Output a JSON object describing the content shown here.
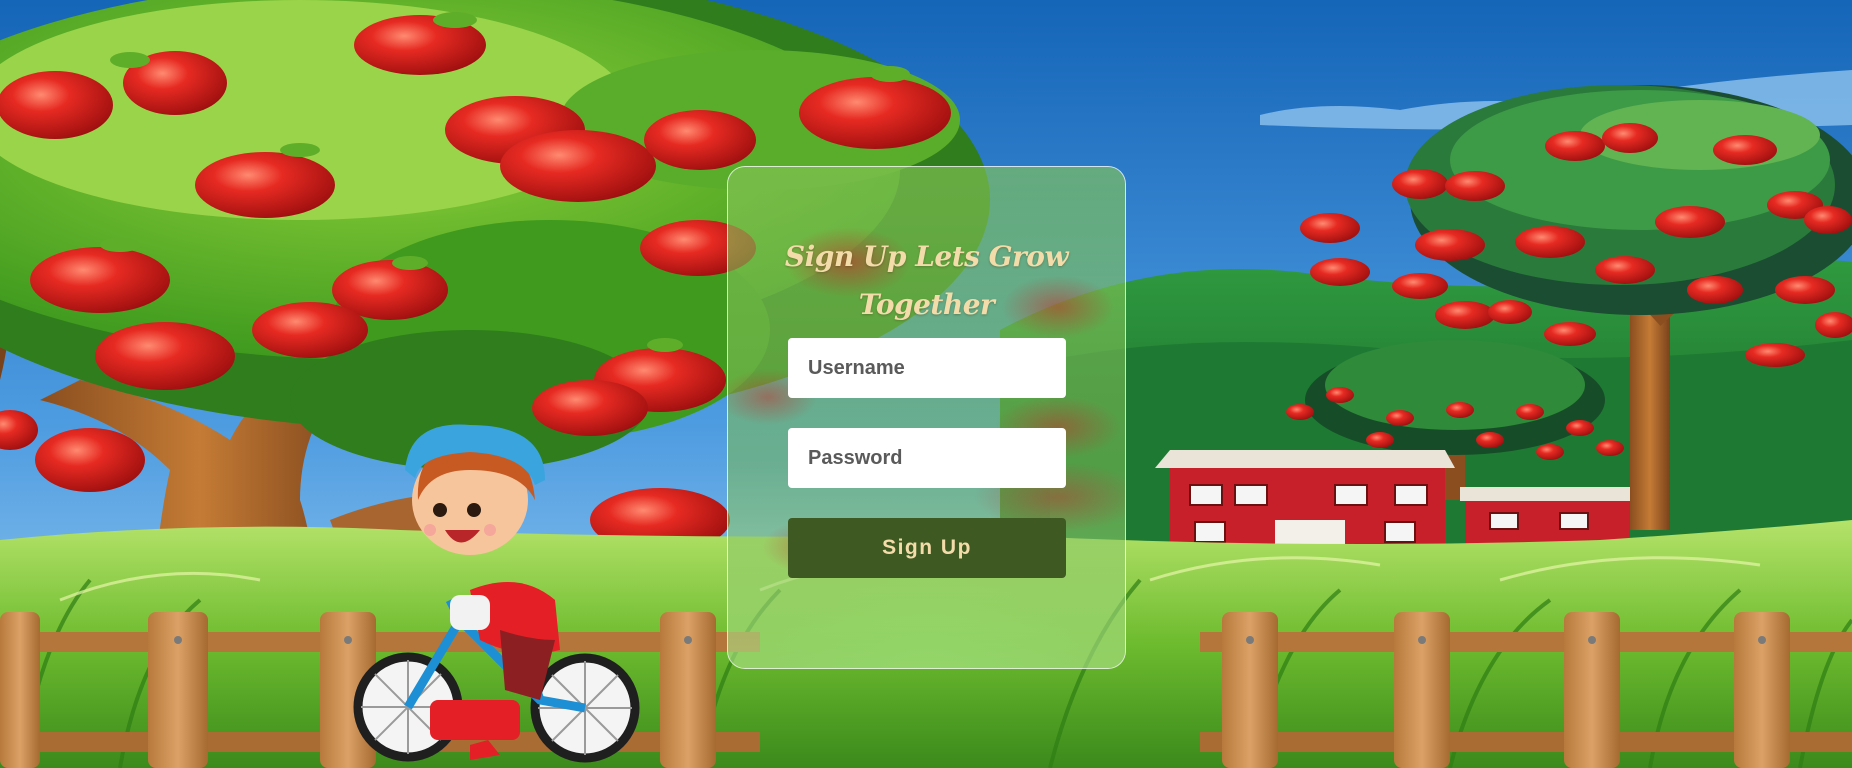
{
  "signup": {
    "title_line1": "Sign Up Lets Grow",
    "title_line2": "Together",
    "username_placeholder": "Username",
    "password_placeholder": "Password",
    "submit_label": "Sign Up"
  },
  "colors": {
    "sky": "#1e6fc0",
    "button": "#3e5a22",
    "title": "#f3dcaa",
    "apple": "#d71f1f"
  }
}
